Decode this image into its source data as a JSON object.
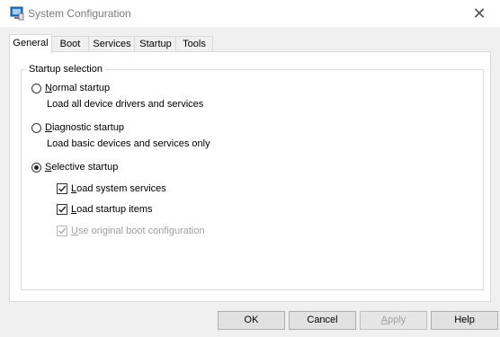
{
  "window": {
    "title": "System Configuration",
    "icon": "system-config-icon",
    "close_glyph": "✕"
  },
  "tabs": [
    {
      "label": "General",
      "active": true
    },
    {
      "label": "Boot",
      "active": false
    },
    {
      "label": "Services",
      "active": false
    },
    {
      "label": "Startup",
      "active": false
    },
    {
      "label": "Tools",
      "active": false
    }
  ],
  "startup_selection": {
    "group_title": "Startup selection",
    "normal": {
      "mnemonic": "N",
      "label_rest": "ormal startup",
      "description": "Load all device drivers and services",
      "selected": false
    },
    "diagnostic": {
      "mnemonic": "D",
      "label_rest": "iagnostic startup",
      "description": "Load basic devices and services only",
      "selected": false
    },
    "selective": {
      "mnemonic": "S",
      "label_rest": "elective startup",
      "selected": true,
      "options": [
        {
          "mnemonic": "L",
          "label_rest": "oad system services",
          "checked": true,
          "enabled": true
        },
        {
          "mnemonic": "L",
          "label_rest": "oad startup items",
          "checked": true,
          "enabled": true
        },
        {
          "mnemonic": "U",
          "label_rest": "se original boot configuration",
          "checked": true,
          "enabled": false
        }
      ]
    }
  },
  "buttons": {
    "ok": "OK",
    "cancel": "Cancel",
    "apply_mnemonic": "A",
    "apply_rest": "pply",
    "help": "Help"
  },
  "colors": {
    "accent": "#0078d7",
    "disabled_text": "#a0a0a0"
  }
}
